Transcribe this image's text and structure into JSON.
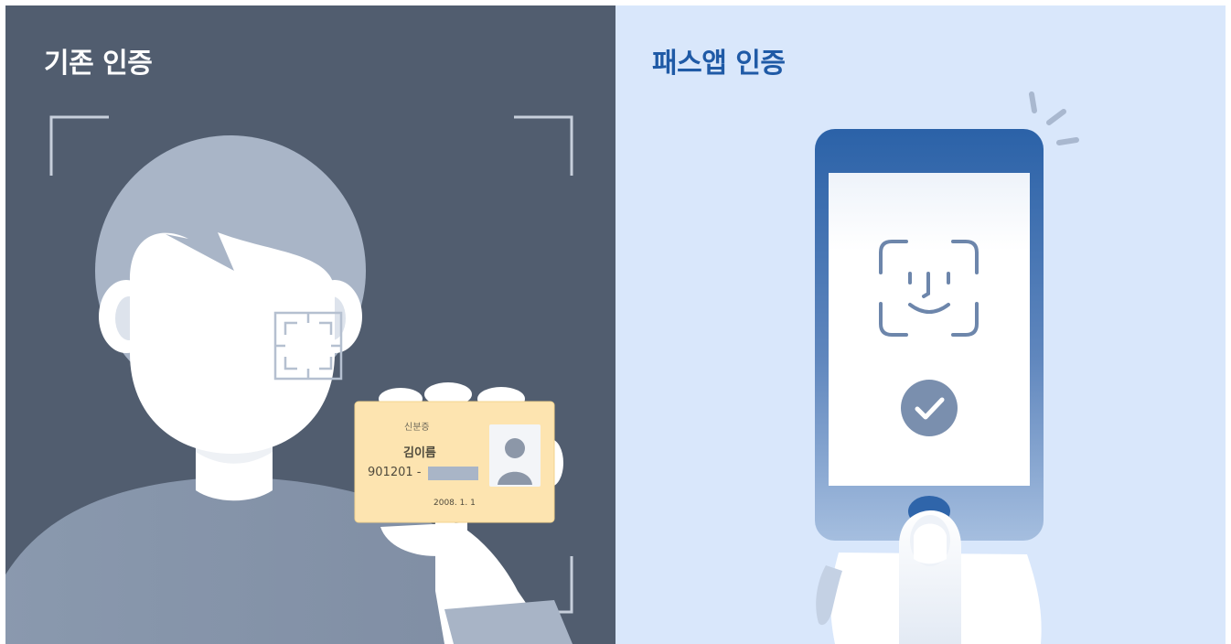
{
  "left_panel": {
    "title": "기존 인증",
    "id_card": {
      "card_type": "신분증",
      "name": "김이름",
      "id_number_prefix": "901201 -",
      "issue_date": "2008. 1. 1"
    }
  },
  "right_panel": {
    "title": "패스앱 인증"
  },
  "colors": {
    "left_background": "#515d6f",
    "right_background": "#d9e7fb",
    "right_title": "#1f5aa6",
    "person_skin": "#ffffff",
    "hair": "#a8b4c6",
    "shirt": "#8796ac",
    "id_card": "#fde4b0",
    "phone_body": "#2f65aa",
    "check_circle": "#7a8fae"
  },
  "icons": [
    "face-id-icon",
    "check-circle-icon",
    "photo-placeholder-icon"
  ]
}
